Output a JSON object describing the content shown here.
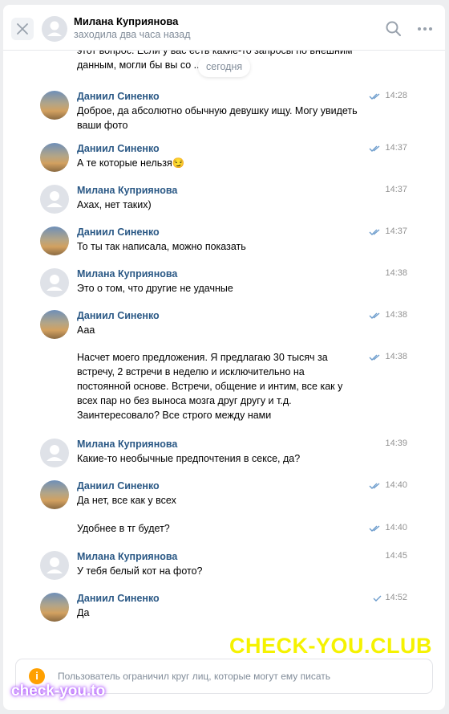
{
  "header": {
    "contact_name": "Милана Куприянова",
    "status": "заходила два часа назад"
  },
  "date_pill": "сегодня",
  "previous_text": "этот вопрос. Если у вас есть какие-то запросы по внешним данным, могли бы вы со ... ?)",
  "messages": [
    {
      "author": "Даниил Синенко",
      "avatar": "photo",
      "time": "14:28",
      "check": "double",
      "text": "Доброе, да абсолютно обычную девушку ищу. Могу увидеть ваши фото"
    },
    {
      "author": "Даниил Синенко",
      "avatar": "photo",
      "time": "14:37",
      "check": "double",
      "text": "А те которые нельзя😏"
    },
    {
      "author": "Милана Куприянова",
      "avatar": "blank",
      "time": "14:37",
      "check": "",
      "text": "Ахах, нет таких)"
    },
    {
      "author": "Даниил Синенко",
      "avatar": "photo",
      "time": "14:37",
      "check": "double",
      "text": "То ты так написала, можно показать"
    },
    {
      "author": "Милана Куприянова",
      "avatar": "blank",
      "time": "14:38",
      "check": "",
      "text": "Это о том, что  другие не удачные"
    },
    {
      "author": "Даниил Синенко",
      "avatar": "photo",
      "time": "14:38",
      "check": "double",
      "text": "Ааа"
    },
    {
      "author": "",
      "avatar": "",
      "time": "14:38",
      "check": "double",
      "text": "Насчет моего предложения. Я предлагаю 30 тысяч за встречу, 2 встречи в неделю и исключительно на постоянной основе. Встречи, общение и интим, все как у всех пар но без выноса мозга друг другу и т.д. Заинтересовало? Все строго между нами"
    },
    {
      "author": "Милана Куприянова",
      "avatar": "blank",
      "time": "14:39",
      "check": "",
      "text": "Какие-то необычные предпочтения в сексе, да?"
    },
    {
      "author": "Даниил Синенко",
      "avatar": "photo",
      "time": "14:40",
      "check": "double",
      "text": "Да нет, все как у всех"
    },
    {
      "author": "",
      "avatar": "",
      "time": "14:40",
      "check": "double",
      "text": "Удобнее в тг будет?"
    },
    {
      "author": "Милана Куприянова",
      "avatar": "blank",
      "time": "14:45",
      "check": "",
      "text": "У тебя белый кот на фото?"
    },
    {
      "author": "Даниил Синенко",
      "avatar": "photo",
      "time": "14:52",
      "check": "single",
      "text": "Да"
    }
  ],
  "composer": {
    "notice": "Пользователь ограничил круг лиц, которые могут ему писать",
    "icon": "warning-icon"
  },
  "watermarks": {
    "top": "CHECK-YOU.CLUB",
    "bottom": "check-you.to"
  },
  "colors": {
    "author_name": "#2a5885",
    "time": "#939393",
    "check": "#6c9ccc",
    "warning": "#ffa000"
  }
}
